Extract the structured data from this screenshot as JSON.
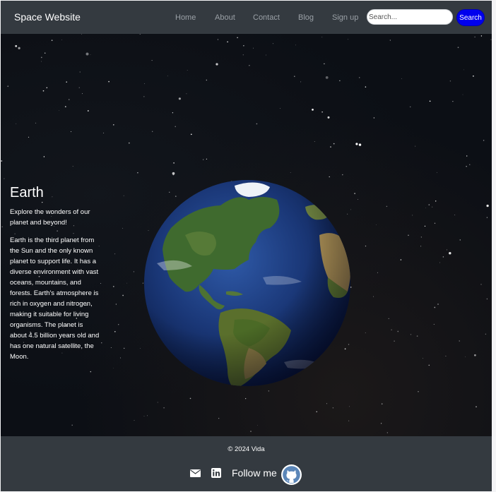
{
  "navbar": {
    "brand": "Space Website",
    "links": [
      "Home",
      "About",
      "Contact",
      "Blog",
      "Sign up"
    ],
    "search": {
      "placeholder": "Search...",
      "button_label": "Search"
    }
  },
  "hero": {
    "title": "Earth",
    "tagline": "Explore the wonders of our planet and beyond!",
    "description": "Earth is the third planet from the Sun and the only known planet to support life. It has a diverse environment with vast oceans, mountains, and forests. Earth's atmosphere is rich in oxygen and nitrogen, making it suitable for living organisms. The planet is about 4.5 billion years old and has one natural satellite, the Moon."
  },
  "footer": {
    "copyright": "© 2024 Vida",
    "follow_label": "Follow me",
    "icons": [
      "mail-icon",
      "linkedin-icon",
      "github-icon"
    ]
  },
  "colors": {
    "navbar_bg": "#343a40",
    "footer_bg": "#343a40",
    "search_button": "#0000ee",
    "nav_link": "#9aa0a6"
  }
}
